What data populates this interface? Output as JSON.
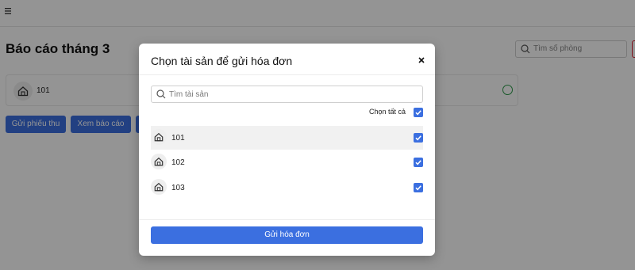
{
  "page": {
    "title": "Báo cáo tháng 3",
    "search_placeholder": "Tìm số phòng",
    "room": {
      "label": "101"
    },
    "buttons": {
      "receipt": "Gửi phiếu thu",
      "view_report": "Xem báo cáo"
    }
  },
  "modal": {
    "title": "Chọn tài sản để gửi hóa đơn",
    "search_placeholder": "Tìm tài sản",
    "select_all_label": "Chọn tất cả",
    "select_all_checked": true,
    "items": [
      {
        "label": "101",
        "checked": true
      },
      {
        "label": "102",
        "checked": true
      },
      {
        "label": "103",
        "checked": true
      }
    ],
    "submit_label": "Gửi hóa đơn"
  },
  "colors": {
    "primary": "#3b6fe0",
    "status_ok": "#2e9b4a",
    "overlay": "rgba(0,0,0,0.42)"
  },
  "icons": [
    "menu-icon",
    "search-icon",
    "house-icon",
    "close-icon",
    "checkmark-icon",
    "status-circle-icon"
  ]
}
